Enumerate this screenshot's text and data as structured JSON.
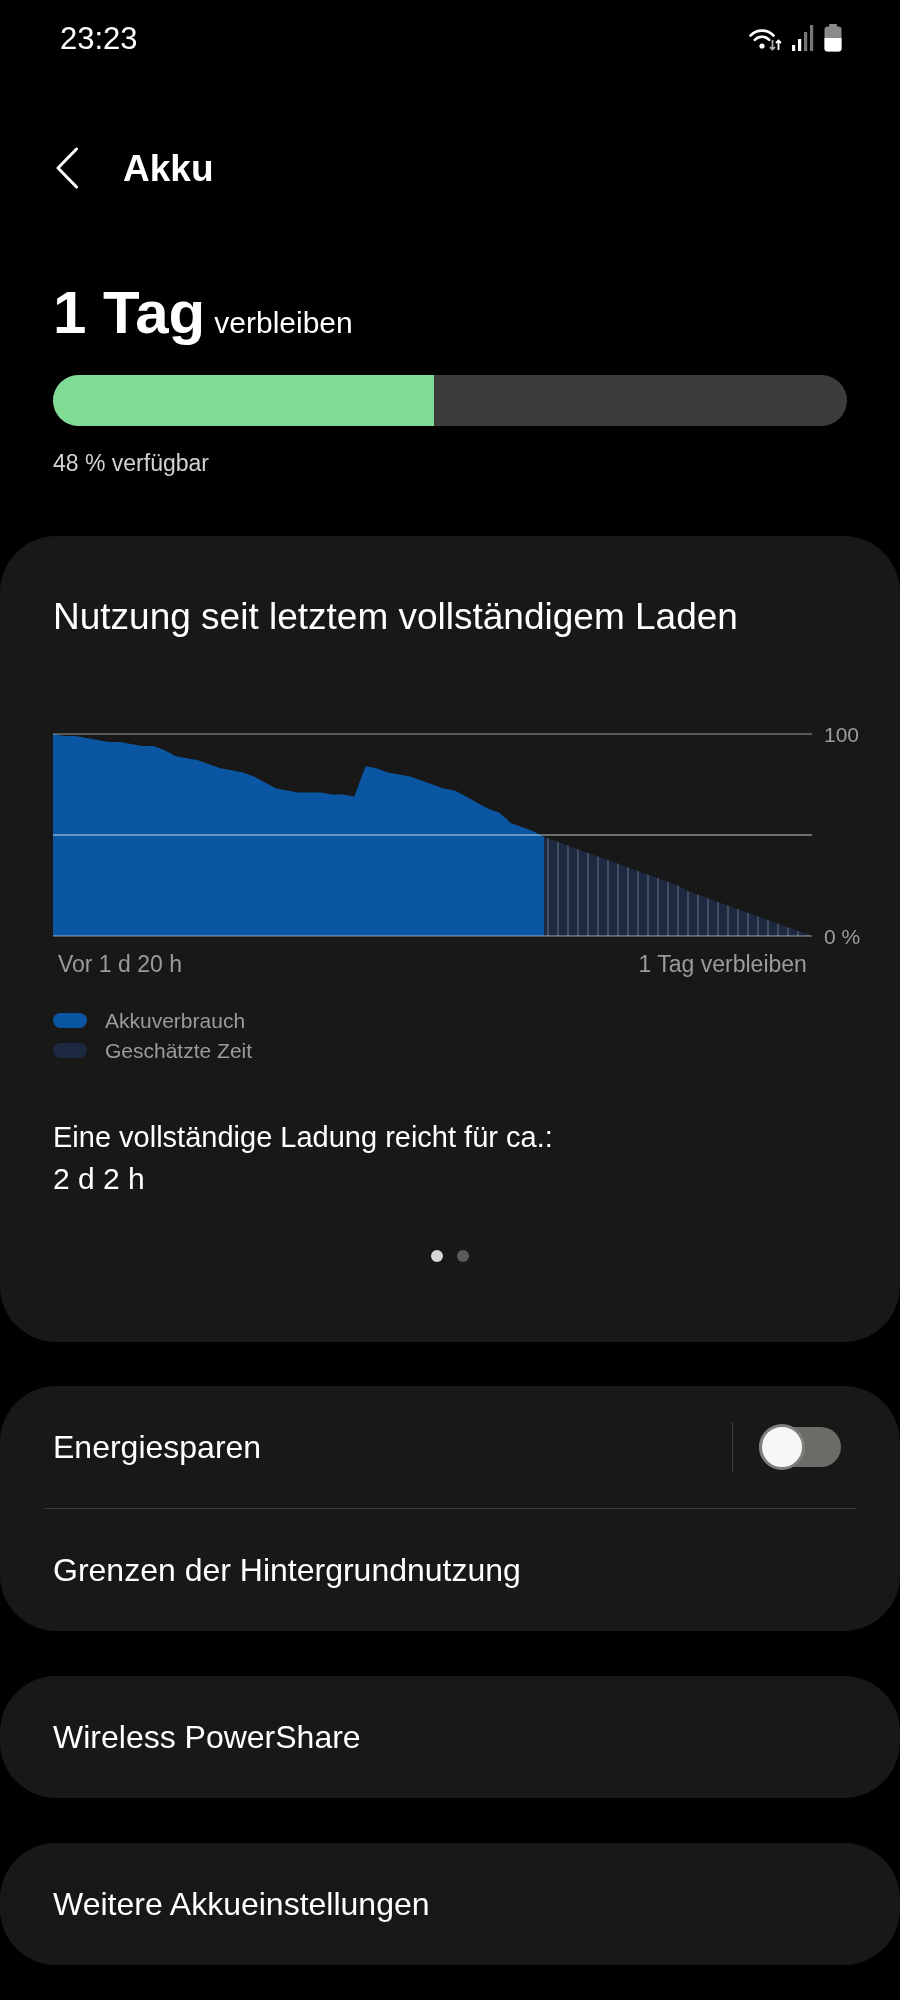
{
  "status_bar": {
    "time": "23:23"
  },
  "header": {
    "title": "Akku"
  },
  "battery": {
    "remaining_value": "1 Tag",
    "remaining_label": "verbleiben",
    "level": 0.48,
    "available": "48 % verfügbar"
  },
  "usage_card": {
    "title": "Nutzung seit letztem vollständigem Laden",
    "chart_data": {
      "type": "area",
      "categories": [
        null,
        null,
        null,
        null,
        null,
        null,
        "Vor 1 d 20 h",
        null,
        null,
        null,
        null,
        null,
        null,
        null,
        null,
        null,
        null,
        null,
        null,
        null,
        null,
        null,
        null,
        null,
        null,
        null,
        null,
        null,
        null,
        null,
        null,
        null,
        null,
        null,
        null,
        null,
        null,
        null,
        null,
        null,
        null,
        null,
        null,
        null,
        null,
        null,
        null,
        null,
        null,
        null,
        null,
        null,
        null,
        null,
        null,
        null,
        null,
        null,
        null,
        null,
        "1 Tag verbleiben",
        null,
        null,
        null,
        null,
        null,
        null,
        null,
        null
      ],
      "series": [
        {
          "name": "Akkuverbrauch",
          "color": "#0a56a2",
          "values": [
            100,
            99,
            99,
            98,
            97,
            96,
            96,
            95,
            94,
            94,
            92,
            89,
            88,
            87,
            85,
            83,
            82,
            81,
            79,
            76,
            73,
            72,
            71,
            71,
            71,
            70,
            70,
            69,
            84,
            83,
            81,
            80,
            79,
            77,
            75,
            73,
            72,
            69,
            66,
            63,
            61,
            56,
            54,
            52,
            49,
            null,
            null,
            null,
            null,
            null,
            null,
            null,
            null,
            null,
            null,
            null,
            null,
            null,
            null,
            null,
            null,
            null,
            null,
            null,
            null,
            null,
            null,
            null,
            null
          ]
        },
        {
          "name": "Geschätzte Zeit",
          "color": "#1c2940",
          "values": [
            null,
            null,
            null,
            null,
            null,
            null,
            null,
            null,
            null,
            null,
            null,
            null,
            null,
            null,
            null,
            null,
            null,
            null,
            null,
            null,
            null,
            null,
            null,
            null,
            null,
            null,
            null,
            null,
            null,
            null,
            null,
            null,
            null,
            null,
            null,
            null,
            null,
            null,
            null,
            null,
            null,
            null,
            null,
            null,
            49,
            47,
            45,
            43,
            41,
            39,
            37,
            35,
            33,
            31,
            29,
            27,
            25,
            22,
            20,
            18,
            16,
            14,
            12,
            10,
            8,
            6,
            4,
            2,
            0
          ]
        }
      ],
      "ylim": [
        0,
        100
      ],
      "yticks": [
        {
          "value": 0,
          "label": "0 %"
        },
        {
          "value": 100,
          "label": "100"
        }
      ]
    },
    "summary_label": "Eine vollständige Ladung reicht für ca.:",
    "summary_value": "2 d 2 h",
    "pages": [
      {
        "selected": true
      },
      {
        "selected": false
      }
    ]
  },
  "settings_groups": [
    {
      "items": [
        {
          "kind": "switch",
          "label": "Energiesparen",
          "on": false
        },
        {
          "kind": "link",
          "label": "Grenzen der Hintergrundnutzung"
        }
      ]
    },
    {
      "items": [
        {
          "kind": "link",
          "label": "Wireless PowerShare"
        }
      ]
    },
    {
      "items": [
        {
          "kind": "link",
          "label": "Weitere Akkueinstellungen"
        }
      ]
    }
  ]
}
